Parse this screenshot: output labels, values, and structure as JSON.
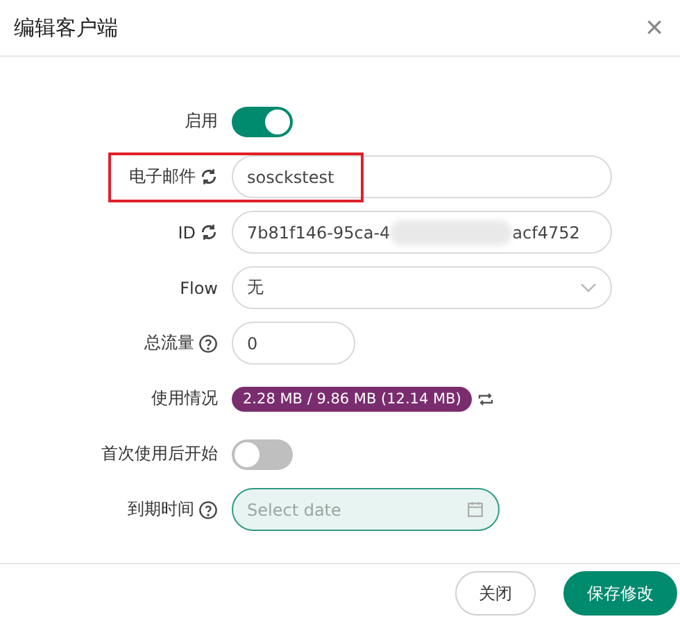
{
  "dialog": {
    "title": "编辑客户端",
    "close": "×"
  },
  "fields": [
    {
      "kind": "switch",
      "label": "启用",
      "on": true
    },
    {
      "kind": "text",
      "label": "电子邮件",
      "refresh": true,
      "value": "sosckstest",
      "highlighted": true
    },
    {
      "kind": "masked",
      "label": "ID",
      "refresh": true,
      "value_start": "7b81f146-95ca-4",
      "value_end": "acf4752"
    },
    {
      "kind": "select",
      "label": "Flow",
      "value": "无"
    },
    {
      "kind": "number",
      "label": "总流量",
      "help": true,
      "value": "0"
    },
    {
      "kind": "usage",
      "label": "使用情况",
      "value": "2.28 MB / 9.86 MB (12.14 MB)"
    },
    {
      "kind": "switch",
      "label": "首次使用后开始",
      "on": false
    },
    {
      "kind": "date",
      "label": "到期时间",
      "help": true,
      "placeholder": "Select date"
    }
  ],
  "buttons": [
    {
      "label": "关闭",
      "kind": "secondary"
    },
    {
      "label": "保存修改",
      "kind": "primary"
    }
  ]
}
